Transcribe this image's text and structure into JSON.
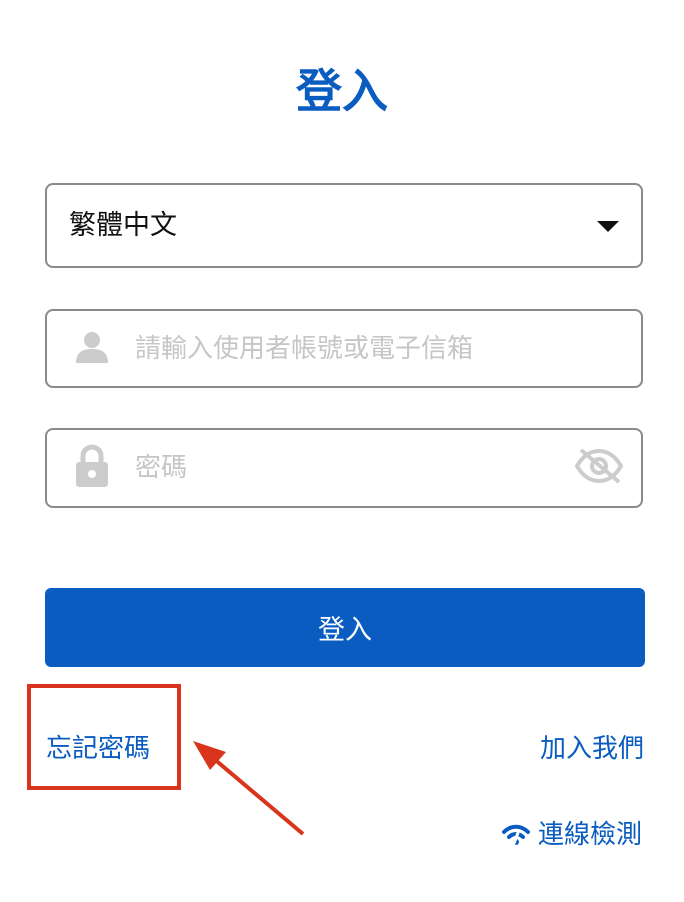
{
  "page": {
    "title": "登入"
  },
  "language_select": {
    "value": "繁體中文"
  },
  "username": {
    "placeholder": "請輸入使用者帳號或電子信箱",
    "value": ""
  },
  "password": {
    "placeholder": "密碼",
    "value": ""
  },
  "actions": {
    "login_label": "登入",
    "forgot_password_label": "忘記密碼",
    "join_label": "加入我們",
    "connection_check_label": "連線檢測"
  },
  "icons": {
    "language_caret": "caret-down-icon",
    "username": "user-icon",
    "password": "lock-icon",
    "password_toggle": "eye-slash-icon",
    "connection_check": "signal-icon"
  },
  "colors": {
    "primary": "#0a5cc0",
    "border": "#8a8a8a",
    "placeholder": "#c6c6c6",
    "annotation": "#d9341c"
  }
}
